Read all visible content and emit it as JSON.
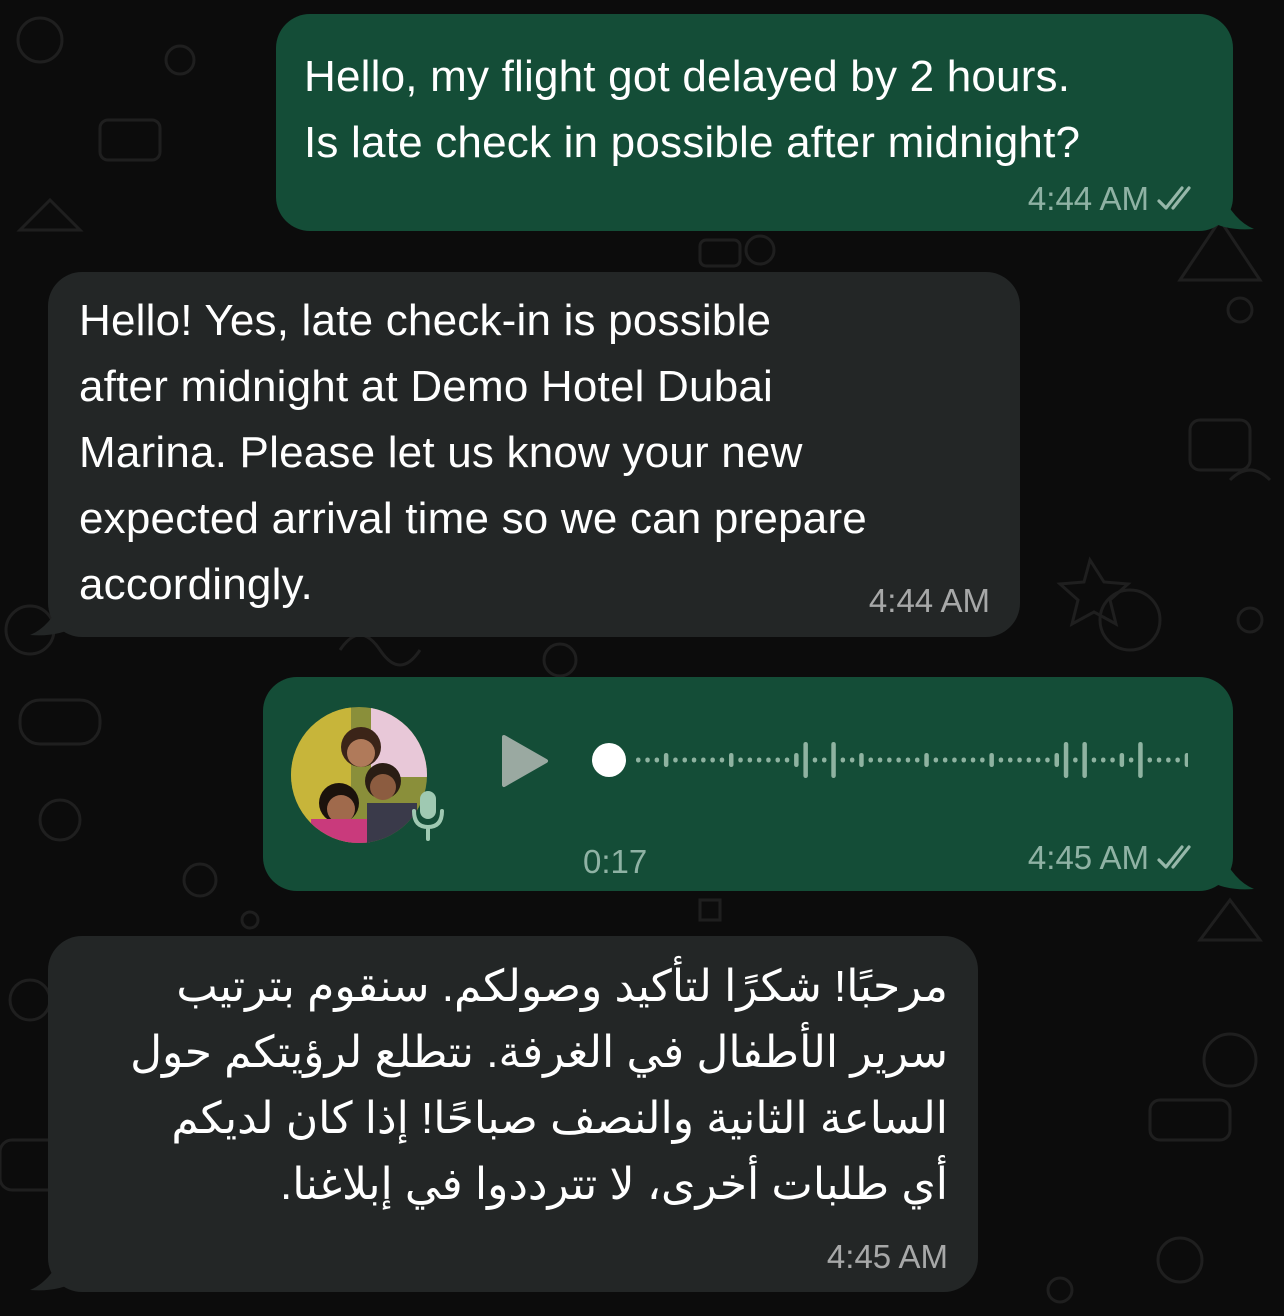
{
  "messages": [
    {
      "id": "m1",
      "direction": "outgoing",
      "text": "Hello, my flight got delayed by 2 hours. Is late check in possible after midnight?",
      "lines": [
        "Hello, my flight got delayed by 2 hours.",
        "Is late check in possible after midnight?"
      ],
      "time": "4:44 AM",
      "status": "read"
    },
    {
      "id": "m2",
      "direction": "incoming",
      "lines": [
        "Hello! Yes, late check-in is possible",
        "after midnight at Demo Hotel Dubai",
        "Marina. Please let us know your new",
        "expected arrival time so we can prepare",
        "accordingly."
      ],
      "time": "4:44 AM"
    },
    {
      "id": "m3",
      "direction": "outgoing",
      "type": "voice",
      "duration": "0:17",
      "progress": 0,
      "time": "4:45 AM",
      "status": "read"
    },
    {
      "id": "m4",
      "direction": "incoming",
      "language": "ar",
      "lines": [
        "مرحبًا! شكرًا لتأكيد وصولكم. سنقوم بترتيب",
        "سرير الأطفال في الغرفة. نتطلع لرؤيتكم حول",
        "الساعة الثانية والنصف صباحًا! إذا كان لديكم",
        "أي طلبات أخرى، لا تترددوا في إبلاغنا."
      ],
      "time": "4:45 AM"
    }
  ],
  "colors": {
    "outgoing_bubble": "#144d37",
    "incoming_bubble": "#232626",
    "background": "#0c0c0c"
  },
  "icons": {
    "read_receipt": "double-check-icon",
    "play": "play-icon",
    "mic": "microphone-icon"
  }
}
